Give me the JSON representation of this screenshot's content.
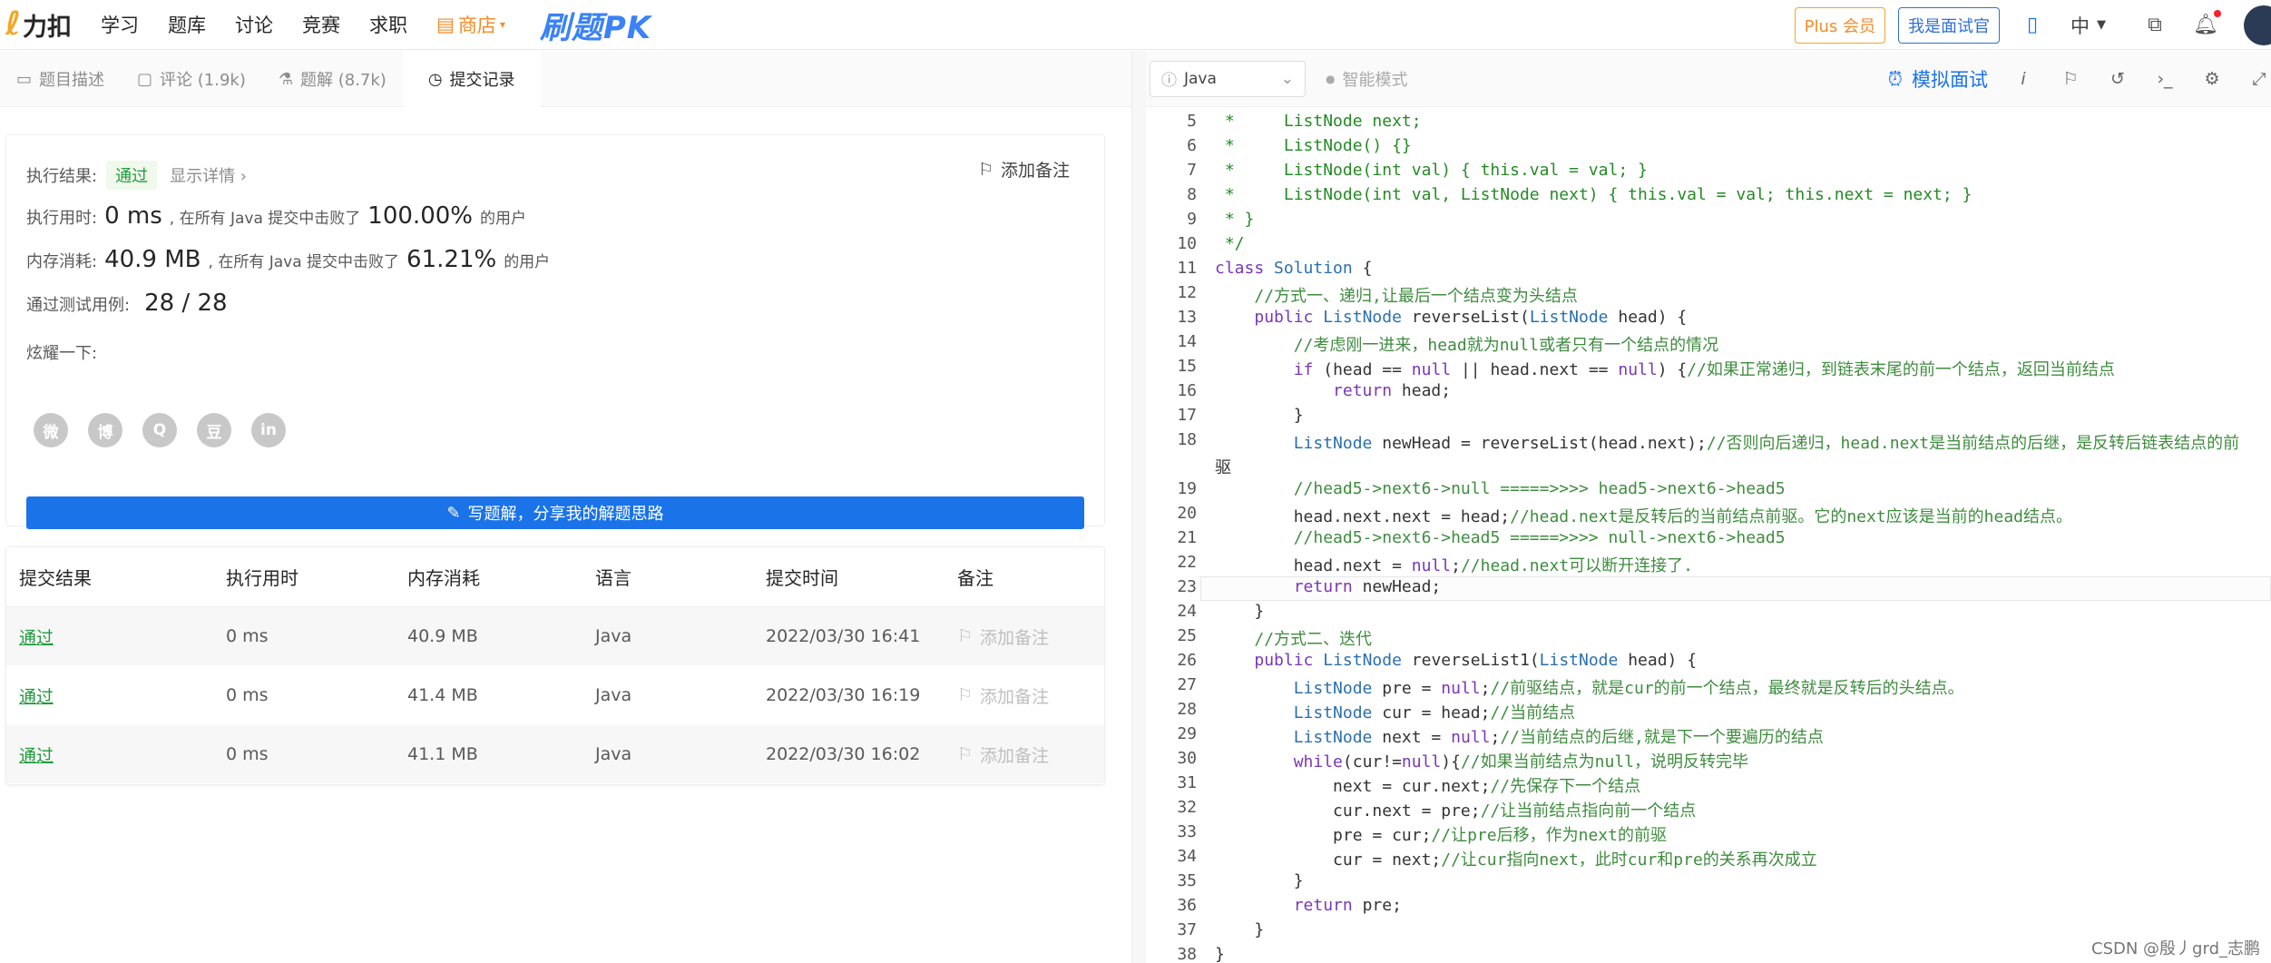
{
  "nav": {
    "logo_text": "力扣",
    "items": [
      "学习",
      "题库",
      "讨论",
      "竞赛",
      "求职"
    ],
    "store": "商店",
    "pk": "刷题PK",
    "plus": "Plus 会员",
    "mock": "我是面试官",
    "lang": "中"
  },
  "tabs": [
    {
      "label": "题目描述",
      "icon": "document-icon"
    },
    {
      "label": "评论 (1.9k)",
      "icon": "comment-icon"
    },
    {
      "label": "题解 (8.7k)",
      "icon": "flask-icon"
    },
    {
      "label": "提交记录",
      "icon": "clock-icon"
    }
  ],
  "result": {
    "exec_label": "执行结果:",
    "status": "通过",
    "detail": "显示详情 ›",
    "add_remark": "添加备注",
    "time_label": "执行用时:",
    "time_value": "0 ms",
    "time_mid": ", 在所有 Java 提交中击败了",
    "time_pct": "100.00%",
    "time_tail": "的用户",
    "mem_label": "内存消耗:",
    "mem_value": "40.9 MB",
    "mem_mid": ", 在所有 Java 提交中击败了",
    "mem_pct": "61.21%",
    "mem_tail": "的用户",
    "tests_label": "通过测试用例:",
    "tests_value": "28 / 28",
    "share_label": "炫耀一下:",
    "share_icons": [
      "微",
      "博",
      "Q",
      "豆",
      "in"
    ],
    "write_button": "写题解，分享我的解题思路"
  },
  "submissions": {
    "headers": [
      "提交结果",
      "执行用时",
      "内存消耗",
      "语言",
      "提交时间",
      "备注"
    ],
    "rows": [
      {
        "result": "通过",
        "time": "0 ms",
        "mem": "40.9 MB",
        "lang": "Java",
        "date": "2022/03/30 16:41",
        "remark": "添加备注"
      },
      {
        "result": "通过",
        "time": "0 ms",
        "mem": "41.4 MB",
        "lang": "Java",
        "date": "2022/03/30 16:19",
        "remark": "添加备注"
      },
      {
        "result": "通过",
        "time": "0 ms",
        "mem": "41.1 MB",
        "lang": "Java",
        "date": "2022/03/30 16:02",
        "remark": "添加备注"
      }
    ]
  },
  "editor": {
    "language": "Java",
    "smart_mode": "智能模式",
    "mock": "模拟面试",
    "current_line": 23
  },
  "code": [
    {
      "n": "5",
      "t": " *     ListNode next;"
    },
    {
      "n": "6",
      "t": " *     ListNode() {}"
    },
    {
      "n": "7",
      "t": " *     ListNode(int val) { this.val = val; }"
    },
    {
      "n": "8",
      "t": " *     ListNode(int val, ListNode next) { this.val = val; this.next = next; }"
    },
    {
      "n": "9",
      "t": " * }"
    },
    {
      "n": "10",
      "t": " */"
    },
    {
      "n": "11",
      "t": "class Solution {"
    },
    {
      "n": "12",
      "t": "    //方式一、递归,让最后一个结点变为头结点"
    },
    {
      "n": "13",
      "t": "    public ListNode reverseList(ListNode head) {"
    },
    {
      "n": "14",
      "t": "        //考虑刚一进来，head就为null或者只有一个结点的情况"
    },
    {
      "n": "15",
      "t": "        if (head == null || head.next == null) {//如果正常递归，到链表末尾的前一个结点，返回当前结点"
    },
    {
      "n": "16",
      "t": "            return head;"
    },
    {
      "n": "17",
      "t": "        }"
    },
    {
      "n": "18",
      "t": "        ListNode newHead = reverseList(head.next);//否则向后递归，head.next是当前结点的后继，是反转后链表结点的前"
    },
    {
      "n": "",
      "t": "驱"
    },
    {
      "n": "19",
      "t": "        //head5->next6->null =====>>>> head5->next6->head5"
    },
    {
      "n": "20",
      "t": "        head.next.next = head;//head.next是反转后的当前结点前驱。它的next应该是当前的head结点。"
    },
    {
      "n": "21",
      "t": "        //head5->next6->head5 =====>>>> null->next6->head5"
    },
    {
      "n": "22",
      "t": "        head.next = null;//head.next可以断开连接了."
    },
    {
      "n": "23",
      "t": "        return newHead;"
    },
    {
      "n": "24",
      "t": "    }"
    },
    {
      "n": "25",
      "t": "    //方式二、迭代"
    },
    {
      "n": "26",
      "t": "    public ListNode reverseList1(ListNode head) {"
    },
    {
      "n": "27",
      "t": "        ListNode pre = null;//前驱结点，就是cur的前一个结点，最终就是反转后的头结点。"
    },
    {
      "n": "28",
      "t": "        ListNode cur = head;//当前结点"
    },
    {
      "n": "29",
      "t": "        ListNode next = null;//当前结点的后继,就是下一个要遍历的结点"
    },
    {
      "n": "30",
      "t": "        while(cur!=null){//如果当前结点为null，说明反转完毕"
    },
    {
      "n": "31",
      "t": "            next = cur.next;//先保存下一个结点"
    },
    {
      "n": "32",
      "t": "            cur.next = pre;//让当前结点指向前一个结点"
    },
    {
      "n": "33",
      "t": "            pre = cur;//让pre后移，作为next的前驱"
    },
    {
      "n": "34",
      "t": "            cur = next;//让cur指向next，此时cur和pre的关系再次成立"
    },
    {
      "n": "35",
      "t": "        }"
    },
    {
      "n": "36",
      "t": "        return pre;"
    },
    {
      "n": "37",
      "t": "    }"
    },
    {
      "n": "38",
      "t": "}"
    }
  ],
  "watermark": "CSDN @殷丿grd_志鹏"
}
